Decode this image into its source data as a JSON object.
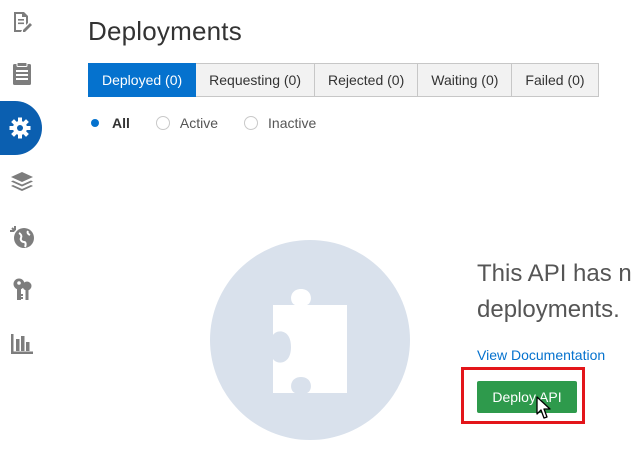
{
  "page": {
    "title": "Deployments"
  },
  "sidebar": {
    "items": [
      {
        "icon": "edit-document-icon",
        "active": false
      },
      {
        "icon": "list-document-icon",
        "active": false
      },
      {
        "icon": "gear-icon",
        "active": true
      },
      {
        "icon": "layers-icon",
        "active": false
      },
      {
        "icon": "globe-icon",
        "active": false
      },
      {
        "icon": "keys-icon",
        "active": false
      },
      {
        "icon": "bar-chart-icon",
        "active": false
      }
    ]
  },
  "tabs": [
    {
      "label": "Deployed (0)",
      "active": true
    },
    {
      "label": "Requesting (0)",
      "active": false
    },
    {
      "label": "Rejected (0)",
      "active": false
    },
    {
      "label": "Waiting (0)",
      "active": false
    },
    {
      "label": "Failed (0)",
      "active": false
    }
  ],
  "filters": [
    {
      "label": "All",
      "checked": true
    },
    {
      "label": "Active",
      "checked": false
    },
    {
      "label": "Inactive",
      "checked": false
    }
  ],
  "empty_state": {
    "line1": "This API has no",
    "line2": "deployments.",
    "link_label": "View Documentation",
    "button_label": "Deploy API",
    "icon": "puzzle-piece-icon"
  },
  "colors": {
    "accent": "#0572ce",
    "rail_active": "#0b5fb0",
    "button": "#2e9a4c",
    "highlight": "#e3151a",
    "illustration": "#d9e1ec",
    "icon_gray": "#7d7d7d"
  }
}
